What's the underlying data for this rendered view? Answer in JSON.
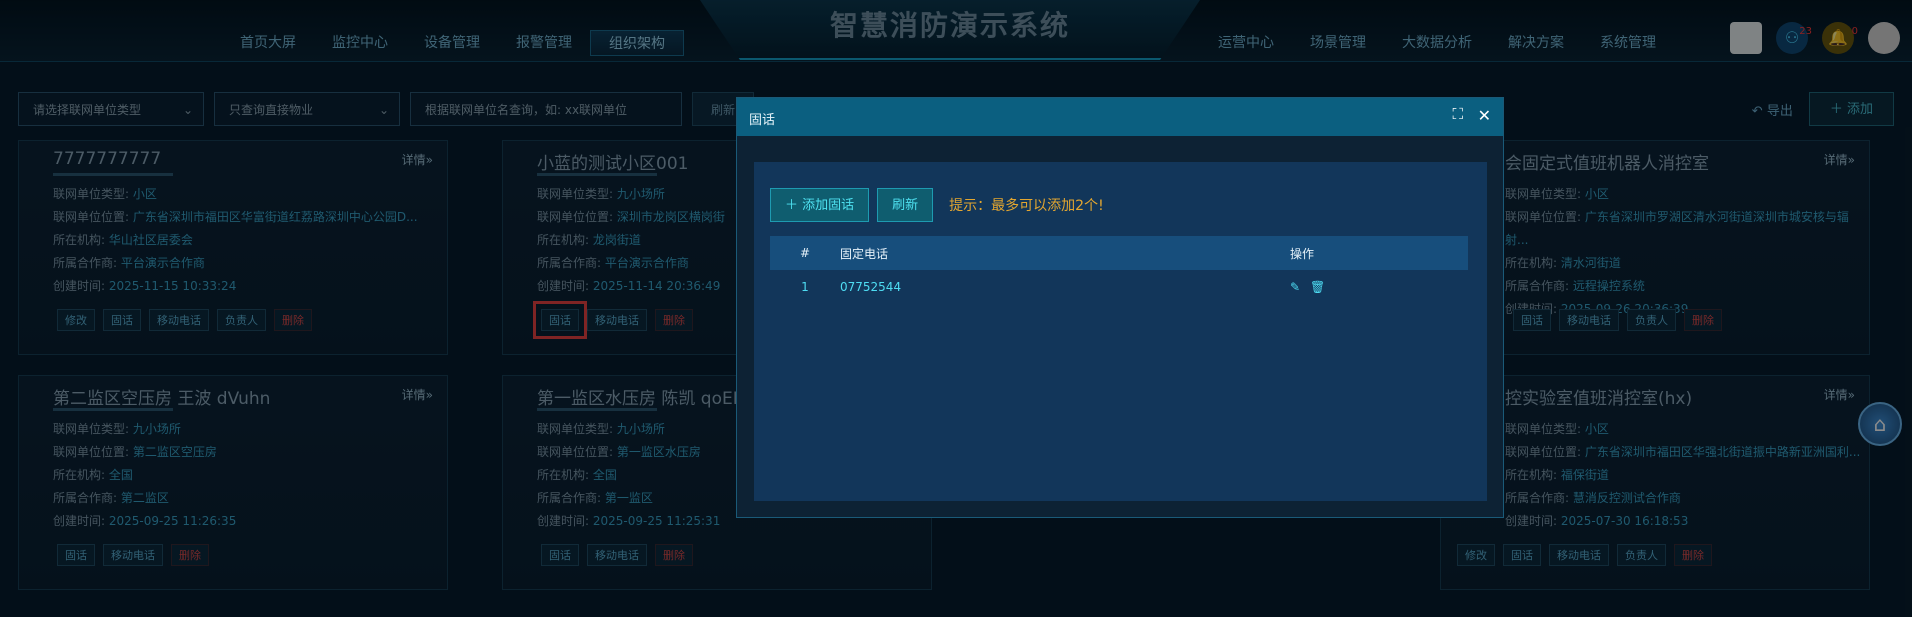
{
  "app": {
    "title": "智慧消防演示系统"
  },
  "nav": {
    "left": [
      "首页大屏",
      "监控中心",
      "设备管理",
      "报警管理",
      "组织架构"
    ],
    "right": [
      "运营中心",
      "场景管理",
      "大数据分析",
      "解决方案",
      "系统管理"
    ],
    "active": "组织架构"
  },
  "header_icons": [
    {
      "name": "qr-icon",
      "badge": ""
    },
    {
      "name": "user-icon",
      "badge": "23"
    },
    {
      "name": "bell-icon",
      "badge": "0"
    },
    {
      "name": "avatar-icon",
      "badge": ""
    }
  ],
  "toolbar": {
    "select_type": "请选择联网单位类型",
    "select_property": "只查询直接物业",
    "search_placeholder": "根据联网单位名查询，如: xx联网单位",
    "refresh": "刷新",
    "export": "导出",
    "add": "添加"
  },
  "labels": {
    "type": "联网单位类型:",
    "location": "联网单位位置:",
    "org": "所在机构:",
    "partner": "所属合作商:",
    "created": "创建时间:",
    "detail": "详情",
    "act_edit": "修改",
    "act_phone": "固话",
    "act_mobile": "移动电话",
    "act_owner": "负责人",
    "act_delete": "删除"
  },
  "cards": [
    {
      "title": "7777777777",
      "type": "小区",
      "location": "广东省深圳市福田区华富街道红荔路深圳中心公园D...",
      "org": "华山社区居委会",
      "partner": "平台演示合作商",
      "created": "2025-11-15 10:33:24"
    },
    {
      "title": "小蓝的测试小区001",
      "type": "九小场所",
      "location": "深圳市龙岗区横岗街",
      "org": "龙岗街道",
      "partner": "平台演示合作商",
      "created": "2025-11-14 20:36:49"
    },
    {
      "title": "会固定式值班机器人消控室",
      "type": "小区",
      "location": "广东省深圳市罗湖区清水河街道深圳市城安核与辐射...",
      "org": "清水河街道",
      "partner": "远程操控系统",
      "created": "2025-09-26 20:36:39"
    },
    {
      "title": "第二监区空压房 王波 dVuhn",
      "type": "九小场所",
      "location": "第二监区空压房",
      "org": "全国",
      "partner": "第二监区",
      "created": "2025-09-25 11:26:35"
    },
    {
      "title": "第一监区水压房 陈凯 qoEKy",
      "type": "九小场所",
      "location": "第一监区水压房",
      "org": "全国",
      "partner": "第一监区",
      "created": "2025-09-25 11:25:31"
    },
    {
      "title": "控实验室值班消控室(hx)",
      "type": "小区",
      "location": "广东省深圳市福田区华强北街道振中路新亚洲国利...",
      "org": "福保街道",
      "partner": "慧消反控测试合作商",
      "created": "2025-07-30 16:18:53"
    }
  ],
  "modal": {
    "title": "固话",
    "add_btn": "添加固话",
    "refresh_btn": "刷新",
    "tip": "提示：最多可以添加2个!",
    "columns": [
      "#",
      "固定电话",
      "操作"
    ],
    "rows": [
      {
        "index": "1",
        "phone": "07752544"
      }
    ]
  }
}
